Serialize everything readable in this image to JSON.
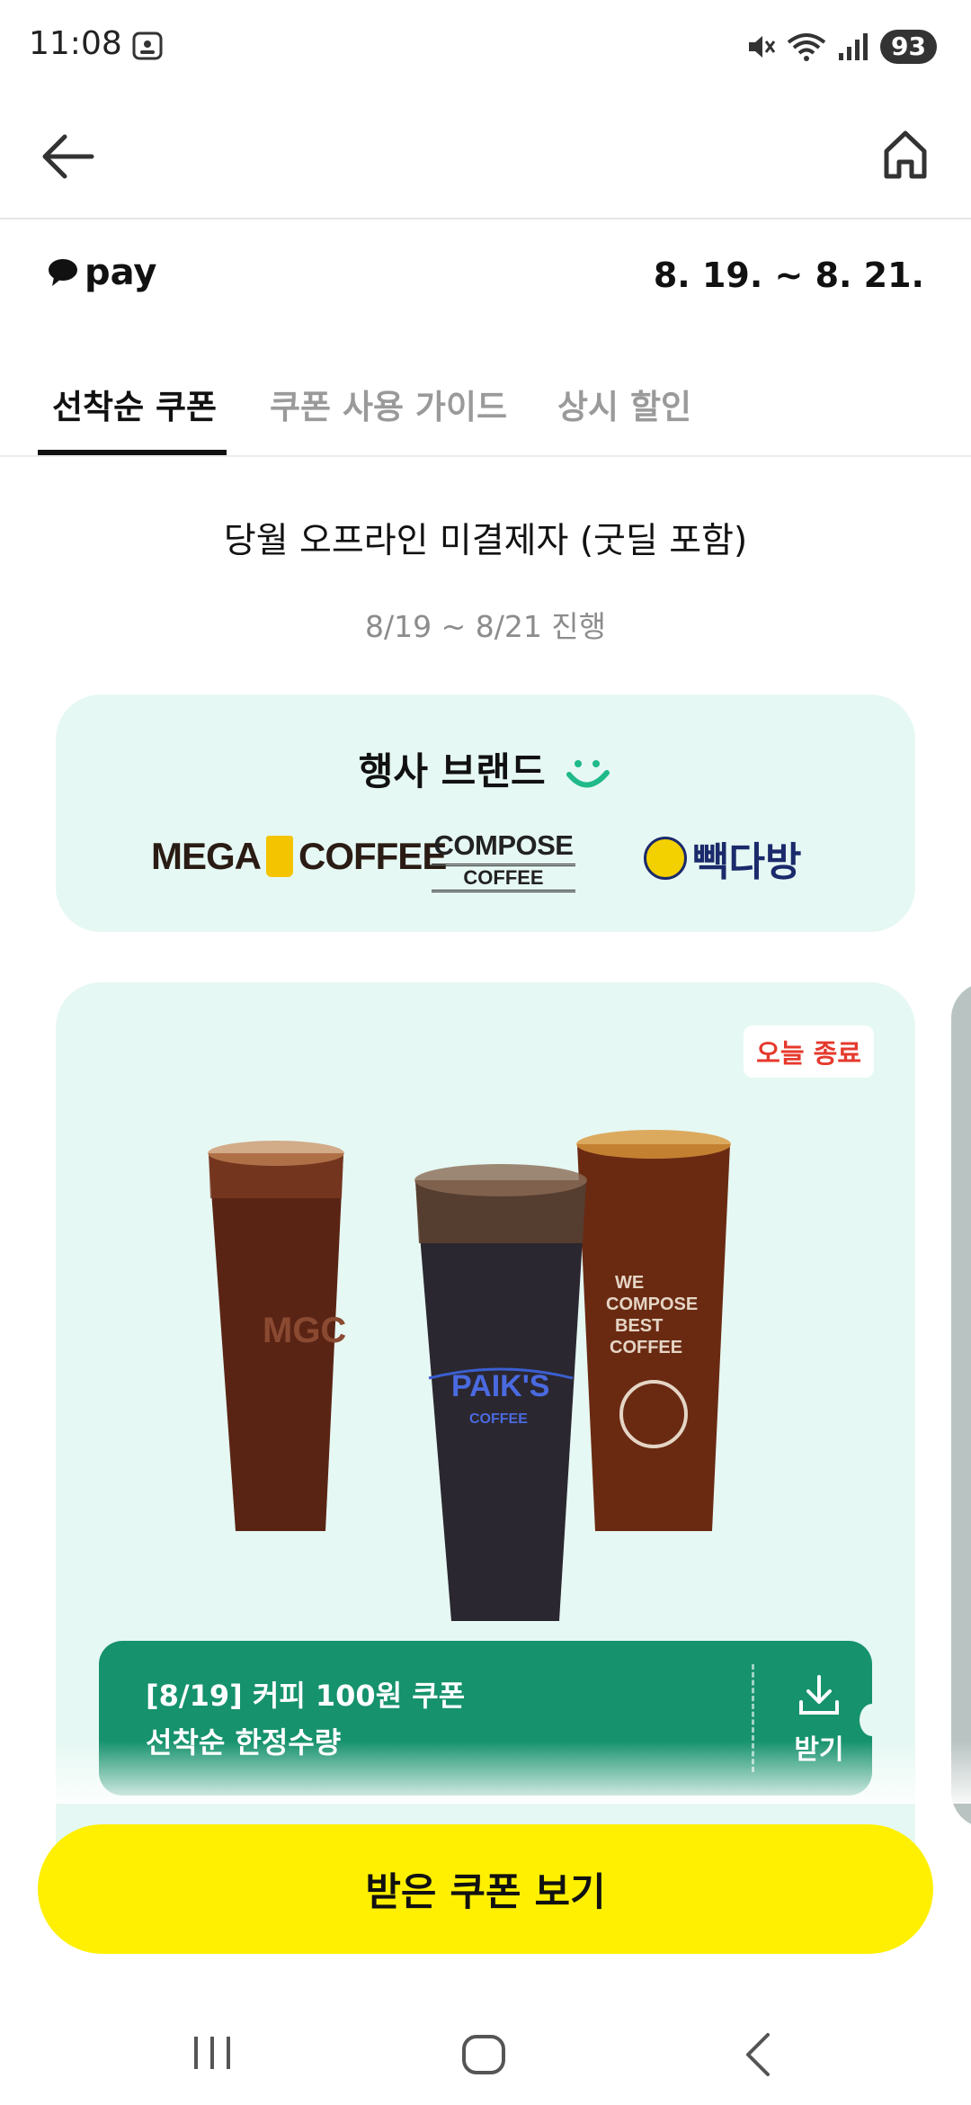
{
  "status_bar": {
    "time": "11:08",
    "battery": "93",
    "icons": [
      "screenshot-icon",
      "mute-icon",
      "wifi-icon",
      "signal-icon",
      "battery-icon"
    ]
  },
  "app_bar": {
    "back_icon": "arrow-left-icon",
    "home_icon": "home-icon"
  },
  "promo": {
    "brand_name": "pay",
    "period": "8. 19. ~ 8. 21."
  },
  "tabs": [
    {
      "label": "선착순 쿠폰",
      "active": true
    },
    {
      "label": "쿠폰 사용 가이드",
      "active": false
    },
    {
      "label": "상시 할인",
      "active": false
    }
  ],
  "target": {
    "title": "당월 오프라인 미결제자 (굿딜 포함)",
    "period": "8/19 ~ 8/21 진행"
  },
  "brands": {
    "title": "행사 브랜드",
    "mega": "MEGA",
    "mega_suffix": "COFFEE",
    "compose_top": "COMPOSE",
    "compose_bottom": "COFFEE",
    "paik": "빽다방"
  },
  "coupon": {
    "badge": "오늘 종료",
    "line1": "[8/19] 커피 100원 쿠폰",
    "line2": "선착순 한정수량",
    "download_label": "받기"
  },
  "cta": {
    "label": "받은 쿠폰 보기"
  },
  "colors": {
    "accent_yellow": "#fef000",
    "card_mint": "#e6f8f3",
    "coupon_green": "#16926d",
    "badge_red": "#e5392d"
  }
}
